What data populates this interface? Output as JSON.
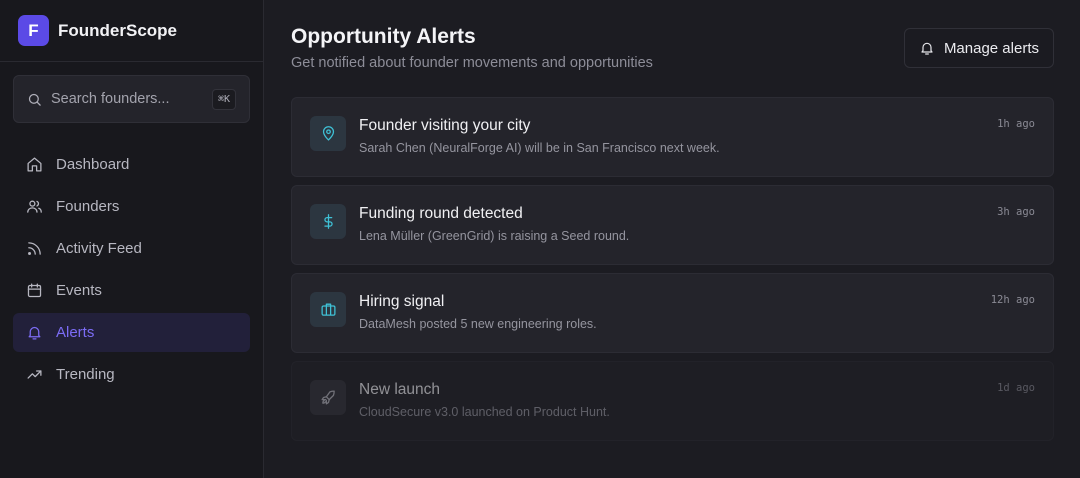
{
  "brand": {
    "logo_letter": "F",
    "name": "FounderScope",
    "accent": "#5b4ae6"
  },
  "search": {
    "placeholder": "Search founders...",
    "shortcut": "⌘K"
  },
  "nav": [
    {
      "label": "Dashboard",
      "icon": "home-icon",
      "active": false
    },
    {
      "label": "Founders",
      "icon": "users-icon",
      "active": false
    },
    {
      "label": "Activity Feed",
      "icon": "rss-icon",
      "active": false
    },
    {
      "label": "Events",
      "icon": "calendar-icon",
      "active": false
    },
    {
      "label": "Alerts",
      "icon": "bell-icon",
      "active": true
    },
    {
      "label": "Trending",
      "icon": "trending-up-icon",
      "active": false
    }
  ],
  "page": {
    "title": "Opportunity Alerts",
    "subtitle": "Get notified about founder movements and opportunities",
    "manage_label": "Manage alerts"
  },
  "alerts": [
    {
      "icon": "map-pin-icon",
      "title": "Founder visiting your city",
      "description": "Sarah Chen (NeuralForge AI) will be in San Francisco next week.",
      "time": "1h ago",
      "read": false
    },
    {
      "icon": "dollar-icon",
      "title": "Funding round detected",
      "description": "Lena Müller (GreenGrid) is raising a Seed round.",
      "time": "3h ago",
      "read": false
    },
    {
      "icon": "briefcase-icon",
      "title": "Hiring signal",
      "description": "DataMesh posted 5 new engineering roles.",
      "time": "12h ago",
      "read": false
    },
    {
      "icon": "rocket-icon",
      "title": "New launch",
      "description": "CloudSecure v3.0 launched on Product Hunt.",
      "time": "1d ago",
      "read": true
    }
  ]
}
